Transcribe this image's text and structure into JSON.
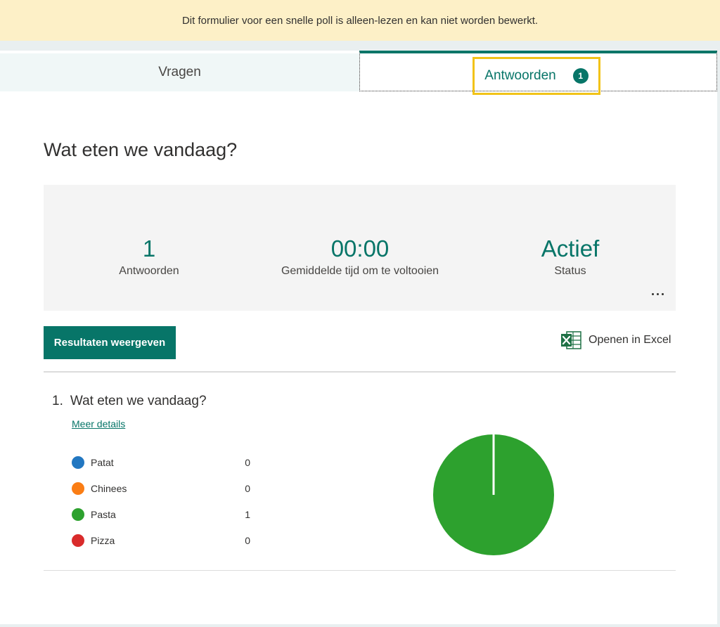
{
  "banner": {
    "text": "Dit formulier voor een snelle poll is alleen-lezen en kan niet worden bewerkt."
  },
  "tabs": {
    "questions_label": "Vragen",
    "responses_label": "Antwoorden",
    "responses_badge": "1"
  },
  "form": {
    "title": "Wat eten we vandaag?"
  },
  "summary": {
    "responses_value": "1",
    "responses_label": "Antwoorden",
    "avg_time_value": "00:00",
    "avg_time_label": "Gemiddelde tijd om te voltooien",
    "status_value": "Actief",
    "status_label": "Status"
  },
  "actions": {
    "view_results_label": "Resultaten weergeven",
    "open_excel_label": "Openen in Excel"
  },
  "question": {
    "number": "1.",
    "title": "Wat eten we vandaag?",
    "more_details": "Meer details",
    "options": [
      {
        "label": "Patat",
        "count": "0",
        "color": "#2277c1"
      },
      {
        "label": "Chinees",
        "count": "0",
        "color": "#fa7d14"
      },
      {
        "label": "Pasta",
        "count": "1",
        "color": "#2da12e"
      },
      {
        "label": "Pizza",
        "count": "0",
        "color": "#d92b2b"
      }
    ]
  },
  "colors": {
    "accent": "#077568",
    "banner_bg": "#fdf0c7",
    "tab_highlight": "#f2c318"
  }
}
